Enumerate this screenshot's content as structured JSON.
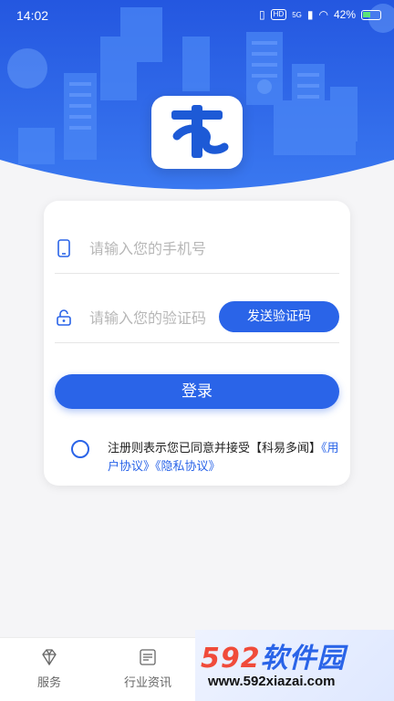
{
  "status_bar": {
    "time": "14:02",
    "network": "5G",
    "hd": "HD",
    "battery": "42%"
  },
  "login_form": {
    "phone_placeholder": "请输入您的手机号",
    "code_placeholder": "请输入您的验证码",
    "send_code_label": "发送验证码",
    "login_label": "登录",
    "agreement_text": "注册则表示您已同意并接受【科易多闻】",
    "user_agreement_link": "《用户协议》",
    "privacy_link": "《隐私协议》"
  },
  "tabbar": {
    "items": [
      {
        "label": "服务",
        "icon": "diamond-icon"
      },
      {
        "label": "行业资讯",
        "icon": "news-icon"
      }
    ]
  },
  "watermark": {
    "big_number": "592",
    "big_text": "软件园",
    "small": "www.592xiazai.com"
  },
  "colors": {
    "accent": "#2a64e8",
    "header_blue": "#2f66e9"
  }
}
